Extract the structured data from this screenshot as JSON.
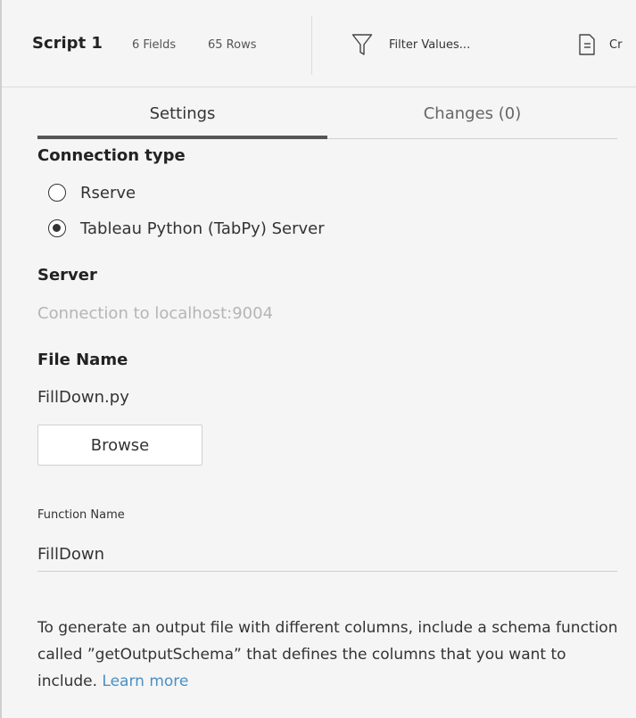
{
  "toolbar": {
    "step_name": "Script 1",
    "fields": "6 Fields",
    "rows": "65 Rows",
    "filter_label": "Filter Values...",
    "create_label": "Cr"
  },
  "tabs": [
    {
      "label": "Settings",
      "active": true
    },
    {
      "label": "Changes (0)",
      "active": false
    }
  ],
  "connection": {
    "heading": "Connection type",
    "options": [
      {
        "label": "Rserve",
        "checked": false
      },
      {
        "label": "Tableau Python (TabPy) Server",
        "checked": true
      }
    ]
  },
  "server": {
    "heading": "Server",
    "value": "Connection to localhost:9004"
  },
  "file": {
    "heading": "File Name",
    "value": "FillDown.py",
    "browse_label": "Browse"
  },
  "function": {
    "label": "Function Name",
    "value": "FillDown"
  },
  "help": {
    "text": "To generate an output file with different columns, include a schema function called ”getOutputSchema” that defines the columns that you want to include.",
    "link": "Learn more"
  },
  "colors": {
    "background": "#f5f5f5",
    "text": "#333333",
    "muted": "#b5b5b5",
    "link": "#4a8fc4",
    "tab_indicator": "#555555"
  },
  "icons": {
    "filter": "filter-icon",
    "create": "calculated-field-icon"
  }
}
